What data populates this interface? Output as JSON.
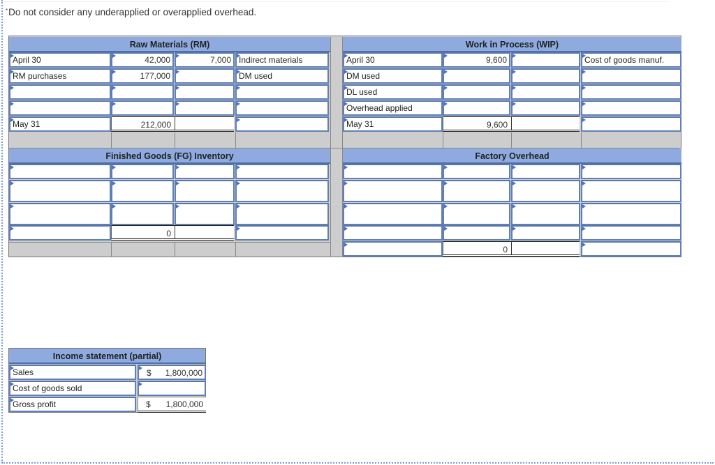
{
  "note": {
    "marker": "*",
    "text": "Do not consider any underapplied or overapplied overhead."
  },
  "raw_materials": {
    "title": "Raw Materials (RM)",
    "rows": [
      {
        "label": "April 30",
        "debit": "42,000",
        "credit": "7,000",
        "credit_label": "Indirect materials"
      },
      {
        "label": "RM purchases",
        "debit": "177,000",
        "credit": "",
        "credit_label": "DM used"
      },
      {
        "label": "",
        "debit": "",
        "credit": "",
        "credit_label": ""
      },
      {
        "label": "",
        "debit": "",
        "credit": "",
        "credit_label": ""
      }
    ],
    "ending": {
      "label": "May 31",
      "balance": "212,000",
      "credit_label": ""
    }
  },
  "work_in_process": {
    "title": "Work in Process (WIP)",
    "rows": [
      {
        "label": "April 30",
        "debit": "9,600",
        "credit": "",
        "credit_label": "Cost of goods manuf."
      },
      {
        "label": "DM used",
        "debit": "",
        "credit": "",
        "credit_label": ""
      },
      {
        "label": "DL used",
        "debit": "",
        "credit": "",
        "credit_label": ""
      },
      {
        "label": "Overhead applied",
        "debit": "",
        "credit": "",
        "credit_label": ""
      }
    ],
    "ending": {
      "label": "May 31",
      "balance": "9,600",
      "credit_label": ""
    }
  },
  "finished_goods": {
    "title": "Finished Goods (FG) Inventory",
    "rows": [
      {
        "label": "",
        "debit": "",
        "credit": "",
        "credit_label": ""
      },
      {
        "label": "",
        "debit": "",
        "credit": "",
        "credit_label": ""
      },
      {
        "label": "",
        "debit": "",
        "credit": "",
        "credit_label": ""
      }
    ],
    "ending": {
      "label": "",
      "balance": "0",
      "credit_label": ""
    }
  },
  "factory_overhead": {
    "title": "Factory Overhead",
    "rows": [
      {
        "label": "",
        "debit": "",
        "credit": "",
        "credit_label": ""
      },
      {
        "label": "",
        "debit": "",
        "credit": "",
        "credit_label": ""
      },
      {
        "label": "",
        "debit": "",
        "credit": "",
        "credit_label": ""
      },
      {
        "label": "",
        "debit": "",
        "credit": "",
        "credit_label": ""
      }
    ],
    "ending": {
      "label": "",
      "balance": "0",
      "credit_label": ""
    }
  },
  "income_statement": {
    "title": "Income statement (partial)",
    "rows": [
      {
        "label": "Sales",
        "currency": "$",
        "value": "1,800,000"
      },
      {
        "label": "Cost of goods sold",
        "currency": "",
        "value": ""
      },
      {
        "label": "Gross profit",
        "currency": "$",
        "value": "1,800,000"
      }
    ]
  },
  "colors": {
    "header_bg": "#8eaadf",
    "input_border": "#5f7fb6",
    "grid_bg": "#cdcdcd",
    "marker": "#4a72c4"
  }
}
